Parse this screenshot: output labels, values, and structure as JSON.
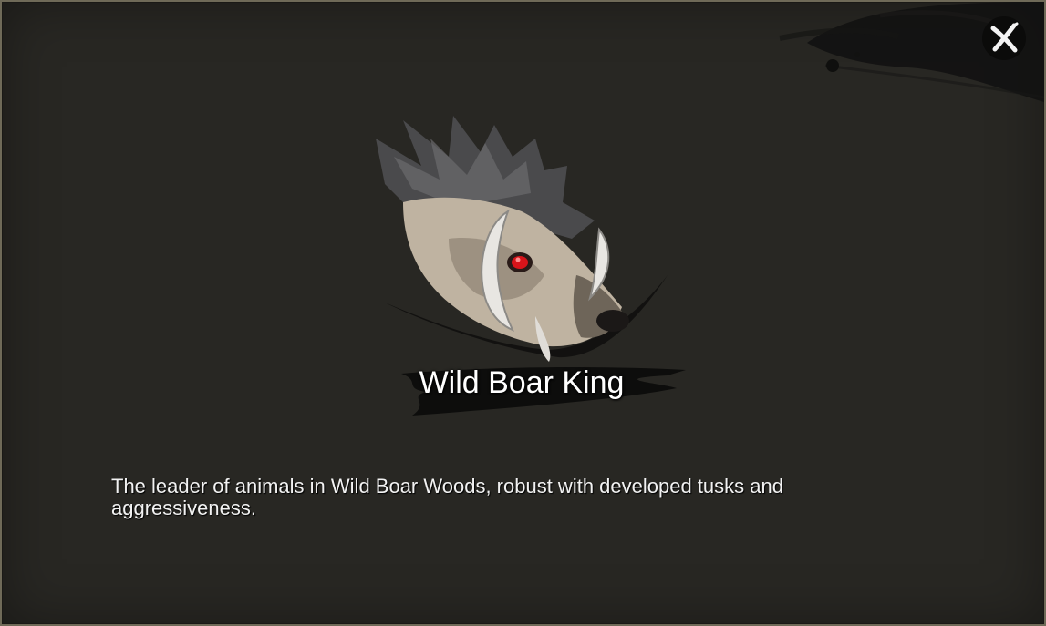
{
  "dialog": {
    "close_icon": "close-x-icon",
    "portrait_icon": "wild-boar-portrait",
    "name": "Wild Boar King",
    "description": "The leader of animals in Wild Boar Woods, robust with developed tusks and aggressiveness."
  },
  "colors": {
    "background": "#282723",
    "border": "#6f6a58",
    "text": "#ffffff",
    "eye": "#d8141a",
    "ink": "#0d0d0c"
  }
}
